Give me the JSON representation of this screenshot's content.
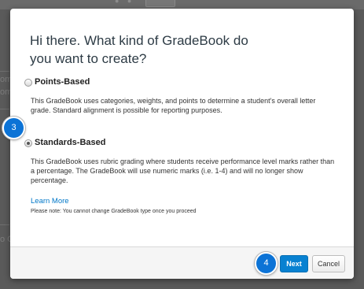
{
  "background": {
    "fragments": [
      "om",
      "om",
      "o G"
    ]
  },
  "modal": {
    "title": "Hi there. What kind of GradeBook do you want to create?",
    "options": [
      {
        "label": "Points-Based",
        "selected": false,
        "description": "This GradeBook uses categories, weights, and points to determine a student's overall letter grade. Standard alignment is possible for reporting purposes."
      },
      {
        "label": "Standards-Based",
        "selected": true,
        "description": "This GradeBook uses rubric grading where students receive performance level marks rather than a percentage. The GradeBook will use numeric marks (i.e. 1-4) and will no longer show percentage."
      }
    ],
    "learn_more": "Learn More",
    "note": "Please note: You cannot change GradeBook type once you proceed",
    "buttons": {
      "next": "Next",
      "cancel": "Cancel"
    }
  },
  "annotations": {
    "step_standards": "3",
    "step_next": "4"
  },
  "colors": {
    "primary_button": "#0881d1",
    "link": "#0077c8",
    "badge": "#0c73d6"
  }
}
